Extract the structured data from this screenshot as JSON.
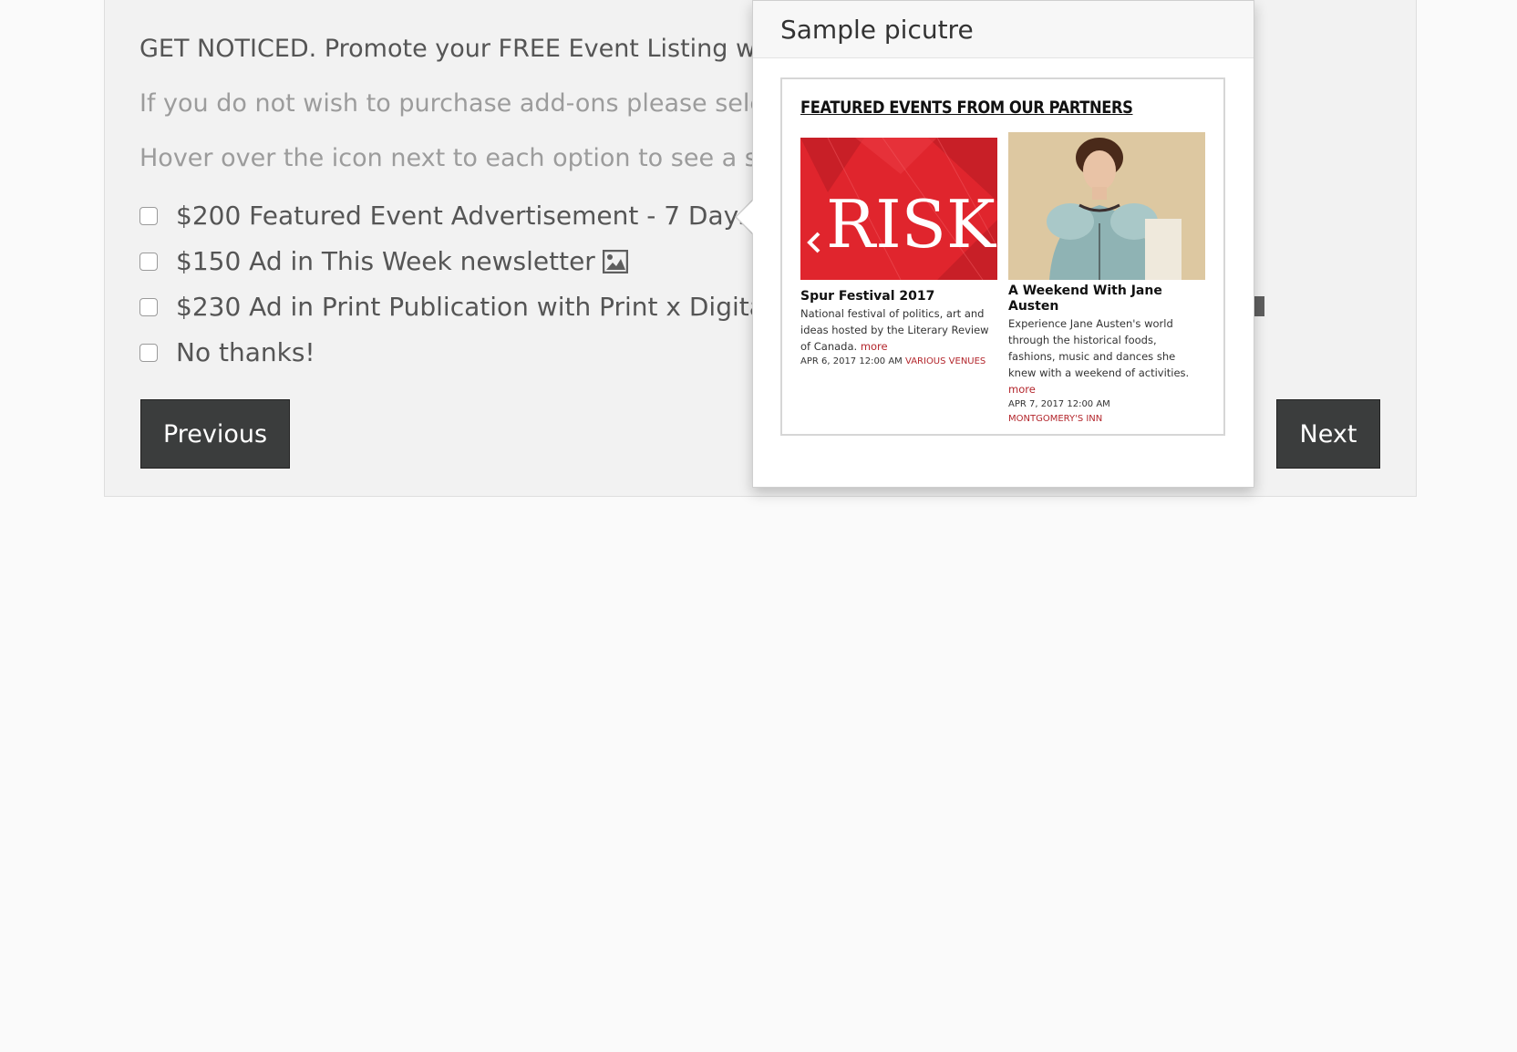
{
  "intro_text": "GET NOTICED. Promote your FREE Event Listing with",
  "note_line1": "If you do not wish to purchase add-ons please selec",
  "note_line2": "Hover over the icon next to each option to see a san",
  "options": [
    {
      "label": "$200 Featured Event Advertisement - 7 Days",
      "has_preview_icon": true
    },
    {
      "label": "$150 Ad in This Week newsletter",
      "has_preview_icon": true
    },
    {
      "label": "$230 Ad in Print Publication with Print x Digital SE",
      "has_preview_icon": true
    },
    {
      "label": "No thanks!",
      "has_preview_icon": false
    }
  ],
  "buttons": {
    "previous": "Previous",
    "next": "Next"
  },
  "popover": {
    "title": "Sample picutre",
    "sample": {
      "heading": "FEATURED EVENTS FROM OUR PARTNERS",
      "cards": [
        {
          "image_text": "RISK",
          "title": "Spur Festival 2017",
          "description": "National festival of politics, art and ideas hosted by the Literary Review of Canada.",
          "more": "more",
          "date": "APR 6, 2017 12:00 AM",
          "venue": "VARIOUS VENUES"
        },
        {
          "title": "A Weekend With Jane Austen",
          "description": "Experience Jane Austen's world through the historical foods, fashions, music and dances she knew with a weekend of activities.",
          "more": "more",
          "date": "APR 7, 2017 12:00 AM",
          "venue": "MONTGOMERY'S INN"
        }
      ]
    }
  },
  "colors": {
    "accent_red": "#b3262c",
    "button_dark": "#3b3d3d",
    "panel_bg": "#f2f2f2"
  }
}
